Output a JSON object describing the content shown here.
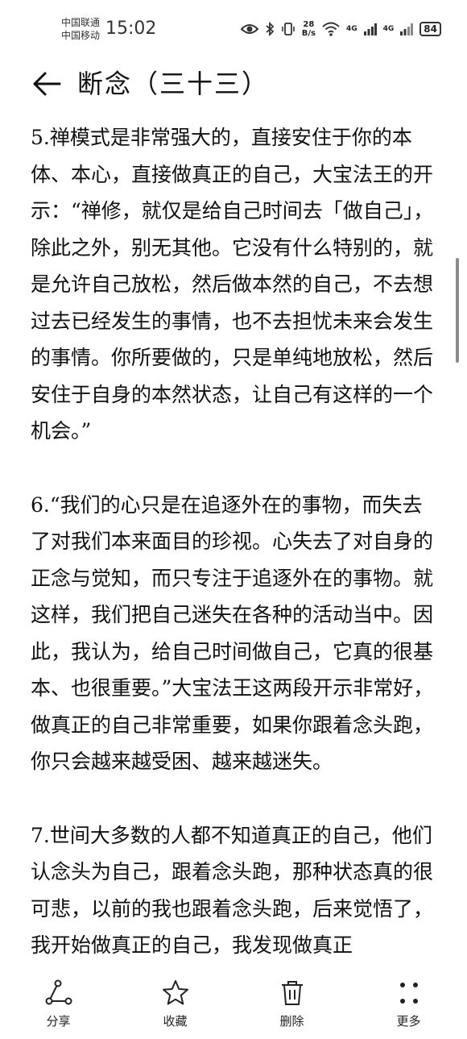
{
  "status_bar": {
    "carrier_1": "中国联通",
    "carrier_2": "中国移动",
    "time": "15:02",
    "net_speed_value": "28",
    "net_speed_unit": "B/s",
    "sim1_type": "4G",
    "sim2_type": "4G",
    "battery": "84"
  },
  "header": {
    "title": "断念（三十三）"
  },
  "article": {
    "paragraphs": [
      "5.禅模式是非常强大的，直接安住于你的本体、本心，直接做真正的自己，大宝法王的开示：“禅修，就仅是给自己时间去「做自己」，除此之外，别无其他。它没有什么特别的，就是允许自己放松，然后做本然的自己，不去想过去已经发生的事情，也不去担忧未来会发生的事情。你所要做的，只是单纯地放松，然后安住于自身的本然状态，让自己有这样的一个机会。”",
      "6.“我们的心只是在追逐外在的事物，而失去了对我们本来面目的珍视。心失去了对自身的正念与觉知，而只专注于追逐外在的事物。就这样，我们把自己迷失在各种的活动当中。因此，我认为，给自己时间做自己，它真的很基本、也很重要。”大宝法王这两段开示非常好，做真正的自己非常重要，如果你跟着念头跑，你只会越来越受困、越来越迷失。",
      "7.世间大多数的人都不知道真正的自己，他们认念头为自己，跟着念头跑，那种状态真的很可悲，以前的我也跟着念头跑，后来觉悟了，我开始做真正的自己，我发现做真正"
    ]
  },
  "bottom_bar": {
    "share": "分享",
    "favorite": "收藏",
    "delete": "删除",
    "more": "更多"
  }
}
